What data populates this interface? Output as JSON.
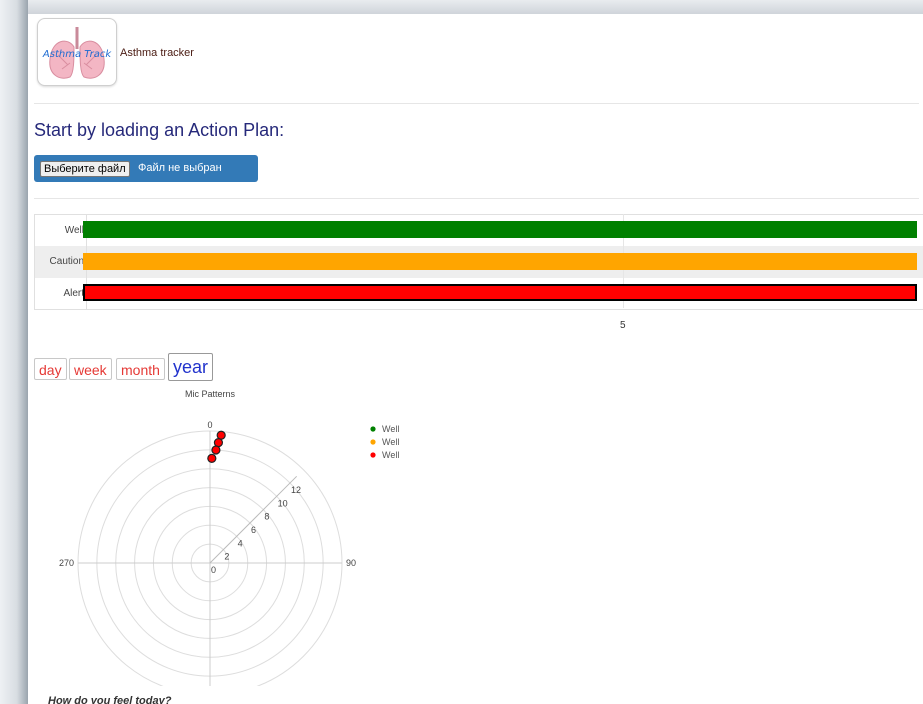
{
  "app": {
    "logo_text": "Asthma Track",
    "title": "Asthma tracker"
  },
  "action_plan": {
    "heading": "Start by loading an Action Plan:",
    "file_button_label": "Выберите файл",
    "file_status": "Файл не выбран"
  },
  "zones": {
    "rows": [
      {
        "label": "Well",
        "color": "#008000"
      },
      {
        "label": "Caution",
        "color": "#FFA500"
      },
      {
        "label": "Alert",
        "color": "#FF0000"
      }
    ],
    "axis_tick": "5"
  },
  "period_buttons": [
    {
      "label": "day",
      "active": false
    },
    {
      "label": "week",
      "active": false
    },
    {
      "label": "month",
      "active": false
    },
    {
      "label": "year",
      "active": true
    }
  ],
  "chart_data": {
    "type": "scatter",
    "subtype": "polar",
    "title": "Mic Patterns",
    "angular_ticks": [
      "0",
      "90",
      "180",
      "270"
    ],
    "radial_ticks": [
      "0",
      "2",
      "4",
      "6",
      "8",
      "10",
      "12"
    ],
    "radial_range": [
      0,
      14
    ],
    "series": [
      {
        "name": "Well",
        "color": "#008000",
        "points": []
      },
      {
        "name": "Well",
        "color": "#FFA500",
        "points": []
      },
      {
        "name": "Well",
        "color": "#FF0000",
        "points": [
          {
            "theta": 5,
            "r": 13.6
          },
          {
            "theta": 4,
            "r": 12.8
          },
          {
            "theta": 3,
            "r": 12.0
          },
          {
            "theta": 1,
            "r": 11.1
          }
        ]
      }
    ],
    "legend_position": "top-right"
  },
  "feel_prompt": "How do you feel today?"
}
